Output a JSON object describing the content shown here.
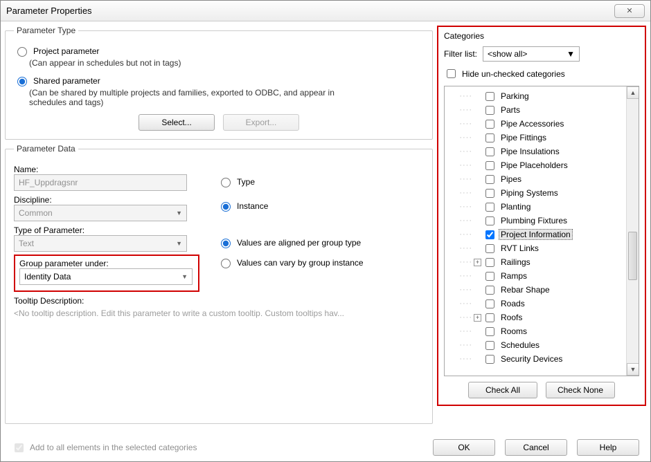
{
  "window": {
    "title": "Parameter Properties"
  },
  "param_type": {
    "legend": "Parameter Type",
    "project_label": "Project parameter",
    "project_sub": "(Can appear in schedules but not in tags)",
    "shared_label": "Shared parameter",
    "shared_sub": "(Can be shared by multiple projects and families, exported to ODBC, and appear in schedules and tags)",
    "select_btn": "Select...",
    "export_btn": "Export..."
  },
  "param_data": {
    "legend": "Parameter Data",
    "name_label": "Name:",
    "name_value": "HF_Uppdragsnr",
    "discipline_label": "Discipline:",
    "discipline_value": "Common",
    "type_of_param_label": "Type of Parameter:",
    "type_of_param_value": "Text",
    "group_under_label": "Group parameter under:",
    "group_under_value": "Identity Data",
    "tooltip_label": "Tooltip Description:",
    "tooltip_value": "<No tooltip description. Edit this parameter to write a custom tooltip. Custom tooltips hav...",
    "radio_type": "Type",
    "radio_instance": "Instance",
    "radio_aligned": "Values are aligned per group type",
    "radio_vary": "Values can vary by group instance"
  },
  "categories": {
    "title": "Categories",
    "filter_label": "Filter list:",
    "filter_value": "<show all>",
    "hide_label": "Hide un-checked categories",
    "check_all": "Check All",
    "check_none": "Check None",
    "items": [
      {
        "label": "Parking",
        "checked": false,
        "expand": false
      },
      {
        "label": "Parts",
        "checked": false,
        "expand": false
      },
      {
        "label": "Pipe Accessories",
        "checked": false,
        "expand": false
      },
      {
        "label": "Pipe Fittings",
        "checked": false,
        "expand": false
      },
      {
        "label": "Pipe Insulations",
        "checked": false,
        "expand": false
      },
      {
        "label": "Pipe Placeholders",
        "checked": false,
        "expand": false
      },
      {
        "label": "Pipes",
        "checked": false,
        "expand": false
      },
      {
        "label": "Piping Systems",
        "checked": false,
        "expand": false
      },
      {
        "label": "Planting",
        "checked": false,
        "expand": false
      },
      {
        "label": "Plumbing Fixtures",
        "checked": false,
        "expand": false
      },
      {
        "label": "Project Information",
        "checked": true,
        "expand": false,
        "selected": true
      },
      {
        "label": "RVT Links",
        "checked": false,
        "expand": false
      },
      {
        "label": "Railings",
        "checked": false,
        "expand": true
      },
      {
        "label": "Ramps",
        "checked": false,
        "expand": false
      },
      {
        "label": "Rebar Shape",
        "checked": false,
        "expand": false
      },
      {
        "label": "Roads",
        "checked": false,
        "expand": false
      },
      {
        "label": "Roofs",
        "checked": false,
        "expand": true
      },
      {
        "label": "Rooms",
        "checked": false,
        "expand": false
      },
      {
        "label": "Schedules",
        "checked": false,
        "expand": false
      },
      {
        "label": "Security Devices",
        "checked": false,
        "expand": false
      }
    ]
  },
  "footer": {
    "add_all": "Add to all elements in the selected categories",
    "ok": "OK",
    "cancel": "Cancel",
    "help": "Help"
  }
}
